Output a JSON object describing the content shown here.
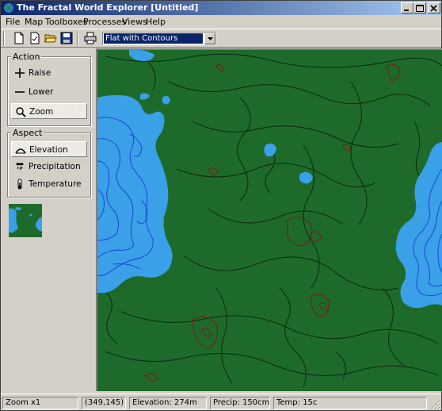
{
  "window": {
    "title": "The Fractal World Explorer [Untitled]"
  },
  "menu": [
    "File",
    "Map",
    "Toolboxes",
    "Processes",
    "Views",
    "Help"
  ],
  "toolbar": {
    "tools": [
      "new-document-icon",
      "new-from-template-icon",
      "open-folder-icon",
      "save-disk-icon",
      "print-icon"
    ],
    "view_mode": "Flat with Contours"
  },
  "action": {
    "title": "Action",
    "items": [
      {
        "label": "Raise",
        "icon": "plus-icon",
        "selected": false
      },
      {
        "label": "Lower",
        "icon": "minus-icon",
        "selected": false
      },
      {
        "label": "Zoom",
        "icon": "magnifier-icon",
        "selected": true
      }
    ]
  },
  "aspect": {
    "title": "Aspect",
    "items": [
      {
        "label": "Elevation",
        "icon": "elevation-icon",
        "selected": true
      },
      {
        "label": "Precipitation",
        "icon": "precipitation-icon",
        "selected": false
      },
      {
        "label": "Temperature",
        "icon": "thermometer-icon",
        "selected": false
      }
    ]
  },
  "map": {
    "colors": {
      "land": "#1e6a2a",
      "shallow_water": "#3aa0e8",
      "deep_water": "#2e86e0",
      "land_contour": "#0a2a0f",
      "water_contour": "#1c3cd8",
      "high_contour": "#7a1a1a"
    }
  },
  "status": {
    "zoom": "Zoom x1",
    "coords": "(349,145)",
    "elevation": "Elevation: 274m",
    "precip": "Precip: 150cm",
    "temp": "Temp: 15c"
  }
}
